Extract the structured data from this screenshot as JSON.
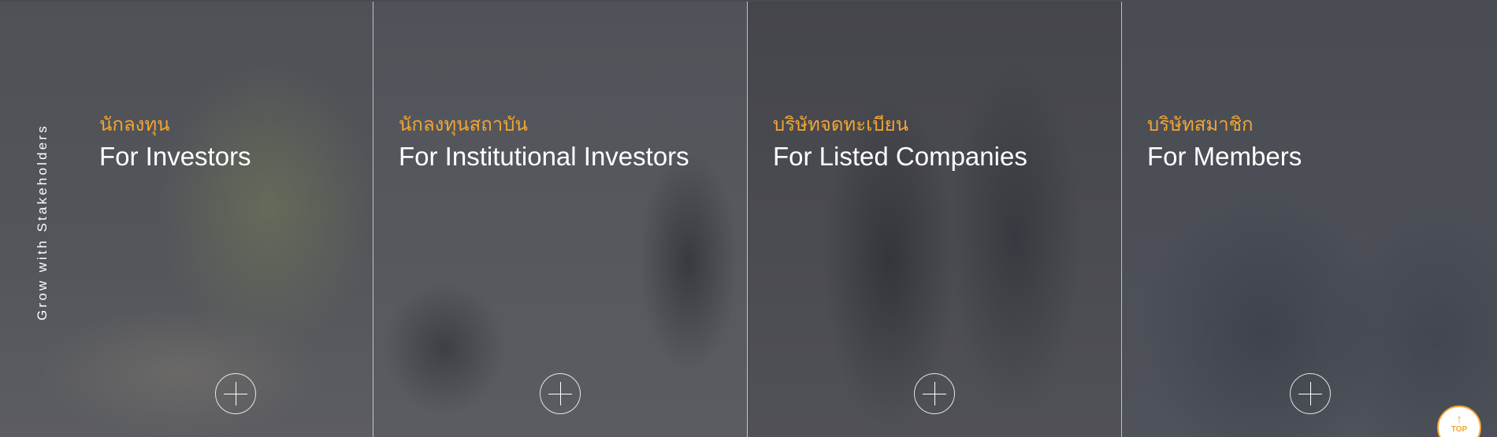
{
  "side_label": "Grow with Stakeholders",
  "panels": [
    {
      "subtitle": "นักลงทุน",
      "title": "For Investors"
    },
    {
      "subtitle": "นักลงทุนสถาบัน",
      "title": "For Institutional Investors"
    },
    {
      "subtitle": "บริษัทจดทะเบียน",
      "title": "For Listed Companies"
    },
    {
      "subtitle": "บริษัทสมาชิก",
      "title": "For Members"
    }
  ],
  "top_button": {
    "arrow": "↑",
    "label": "TOP"
  },
  "colors": {
    "accent": "#f2a531",
    "overlay": "#4a4b52",
    "text": "#ffffff"
  }
}
